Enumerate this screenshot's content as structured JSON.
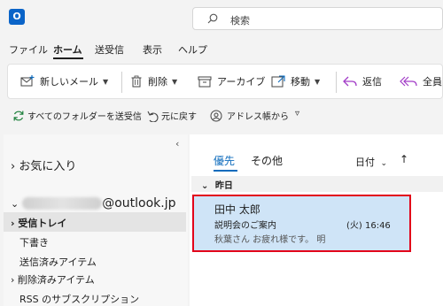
{
  "app": {
    "logo_letter": "O"
  },
  "search": {
    "placeholder": "検索"
  },
  "menu_tabs": [
    "ファイル",
    "ホーム",
    "送受信",
    "表示",
    "ヘルプ"
  ],
  "ribbon": {
    "new_mail": "新しいメール",
    "delete": "削除",
    "archive": "アーカイブ",
    "move": "移動",
    "reply": "返信",
    "reply_all": "全員"
  },
  "ribbon2": {
    "send_receive_all": "すべてのフォルダーを送受信",
    "undo": "元に戻す",
    "address_book": "アドレス帳から",
    "more": "▿"
  },
  "nav": {
    "favorites": "お気に入り",
    "account_suffix": "@outlook.jp",
    "items": [
      "受信トレイ",
      "下書き",
      "送信済みアイテム",
      "削除済みアイテム",
      "RSS のサブスクリプション"
    ]
  },
  "list": {
    "focused": "優先",
    "other": "その他",
    "sort": "日付",
    "group": "昨日"
  },
  "email": {
    "sender": "田中 太郎",
    "subject": "説明会のご案内",
    "preview": "秋葉さん お疲れ様です。 明",
    "time": "(火) 16:46"
  },
  "colors": {
    "accent": "#0f6cbd",
    "highlight": "#e2001a",
    "selected_bg": "#cfe4f7"
  }
}
